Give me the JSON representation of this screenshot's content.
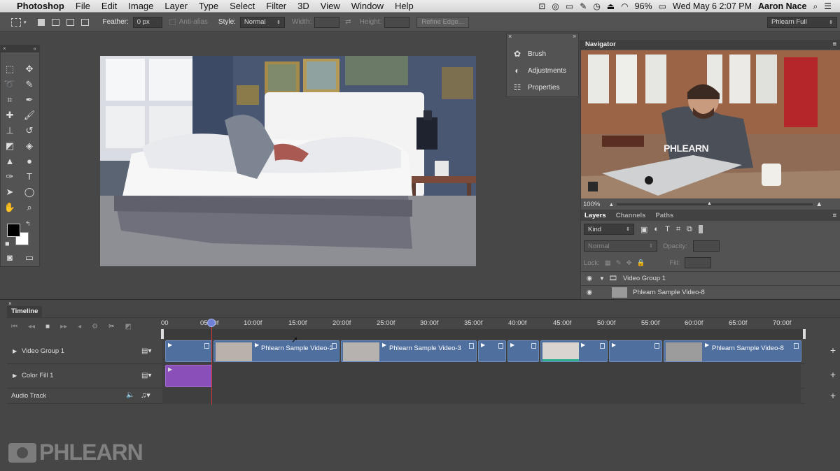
{
  "menubar": {
    "apple": "",
    "app": "Photoshop",
    "items": [
      "File",
      "Edit",
      "Image",
      "Layer",
      "Type",
      "Select",
      "Filter",
      "3D",
      "View",
      "Window",
      "Help"
    ],
    "battery": "96%",
    "datetime": "Wed May 6  2:07 PM",
    "user": "Aaron Nace"
  },
  "options": {
    "feather_label": "Feather:",
    "feather_value": "0 px",
    "antialias": "Anti-alias",
    "style_label": "Style:",
    "style_value": "Normal",
    "width_label": "Width:",
    "height_label": "Height:",
    "refine_edge": "Refine Edge...",
    "workspace": "Phlearn Full"
  },
  "mini_panels": {
    "brush": "Brush",
    "adjustments": "Adjustments",
    "properties": "Properties"
  },
  "navigator": {
    "title": "Navigator",
    "zoom": "100%",
    "shirt_text": "PHLEARN"
  },
  "layers_panel": {
    "tabs": [
      "Layers",
      "Channels",
      "Paths"
    ],
    "kind": "Kind",
    "blend_mode": "Normal",
    "opacity_label": "Opacity:",
    "lock_label": "Lock:",
    "fill_label": "Fill:",
    "rows": [
      {
        "name": "Video Group 1"
      },
      {
        "name": "Phlearn Sample Video-8"
      }
    ]
  },
  "timeline": {
    "title": "Timeline",
    "ruler": [
      "00",
      "05:00f",
      "10:00f",
      "15:00f",
      "20:00f",
      "25:00f",
      "30:00f",
      "35:00f",
      "40:00f",
      "45:00f",
      "50:00f",
      "55:00f",
      "60:00f",
      "65:00f",
      "70:00f"
    ],
    "tracks": [
      {
        "name": "Video Group 1"
      },
      {
        "name": "Color Fill 1"
      },
      {
        "name": "Audio Track"
      }
    ],
    "clip_labels": [
      "Phlearn Sample Video-2",
      "Phlearn Sample Video-3",
      "Phlearn Sample Video-8"
    ]
  },
  "watermark": "PHLEARN",
  "colors": {
    "clip_blue": "#4f6f9f",
    "color_fill_purple": "#8a4fb8",
    "playhead": "#6d7fd6"
  }
}
